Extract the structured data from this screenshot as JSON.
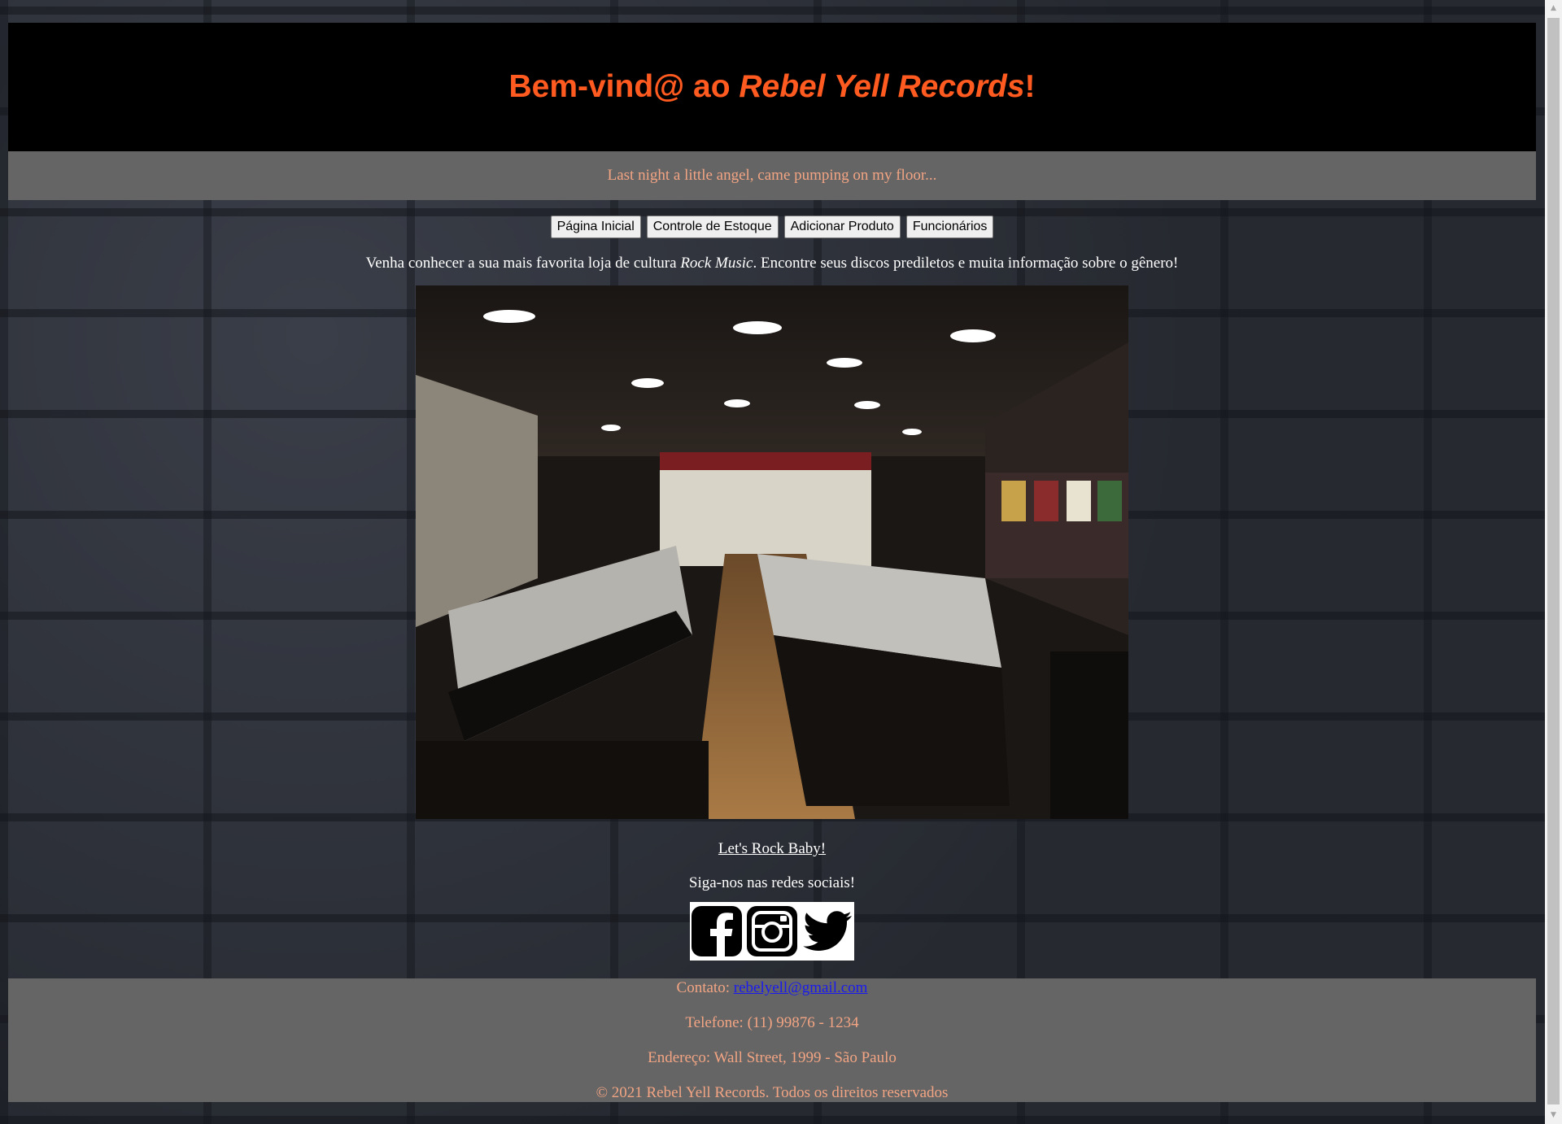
{
  "header": {
    "title_prefix": "Bem-vind@ ao ",
    "title_brand": "Rebel Yell Records",
    "title_suffix": "!",
    "tagline": "Last night a little angel, came pumping on my floor..."
  },
  "nav": {
    "items": [
      {
        "label": "Página Inicial"
      },
      {
        "label": "Controle de Estoque"
      },
      {
        "label": "Adicionar Produto"
      },
      {
        "label": "Funcionários"
      }
    ]
  },
  "main": {
    "intro_before": "Venha conhecer a sua mais favorita loja de cultura ",
    "intro_em": "Rock Music",
    "intro_after": ". Encontre seus discos prediletos e muita informação sobre o gênero!",
    "rock_link": "Let's Rock Baby!",
    "follow_text": "Siga-nos nas redes sociais!",
    "social_icons": [
      "facebook-icon",
      "instagram-icon",
      "twitter-icon"
    ]
  },
  "footer": {
    "contact_label": "Contato: ",
    "contact_email": "rebelyell@gmail.com",
    "phone": "Telefone: (11) 99876 - 1234",
    "address": "Endereço: Wall Street, 1999 - São Paulo",
    "copyright": "© 2021 Rebel Yell Records. Todos os direitos reservados"
  },
  "colors": {
    "title": "#ff5a1f",
    "tagline": "#f2a483",
    "header_bg": "#000000",
    "bar_bg": "#656565",
    "link": "#1a1aee"
  }
}
